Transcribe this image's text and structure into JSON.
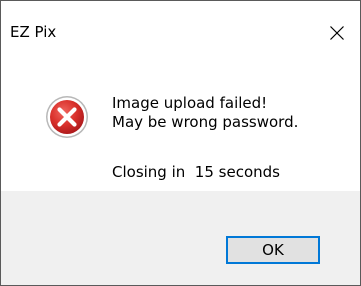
{
  "window": {
    "title": "EZ Pix",
    "close_icon": "close-icon"
  },
  "message": {
    "icon": "error-icon",
    "line1": "Image upload failed!",
    "line2": "May be wrong password.",
    "countdown": "Closing in  15 seconds"
  },
  "buttons": {
    "ok_label": "OK"
  },
  "colors": {
    "error_red": "#d9302b",
    "focus_border": "#0078d7",
    "footer_bg": "#f0f0f0",
    "button_bg": "#e1e1e1"
  }
}
